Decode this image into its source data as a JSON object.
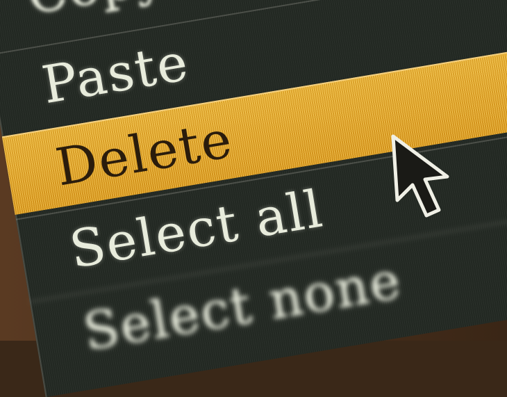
{
  "context_menu": {
    "items": [
      {
        "label": "Copy",
        "state": "normal"
      },
      {
        "label": "Paste",
        "state": "normal"
      },
      {
        "label": "Delete",
        "state": "highlighted"
      },
      {
        "label": "Select all",
        "state": "normal"
      },
      {
        "label": "Select none",
        "state": "normal"
      }
    ],
    "colors": {
      "background": "#242a24",
      "text": "#e8ecdc",
      "highlight": "#e8a92a",
      "highlight_text": "#2a1c0c"
    }
  },
  "cursor": {
    "icon": "arrow-pointer-icon"
  }
}
